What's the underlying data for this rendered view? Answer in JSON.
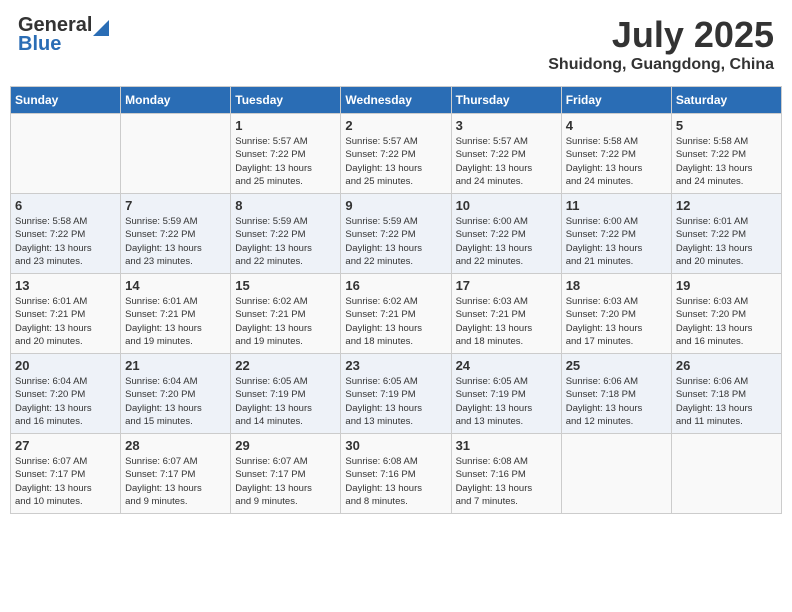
{
  "header": {
    "logo_general": "General",
    "logo_blue": "Blue",
    "month": "July 2025",
    "location": "Shuidong, Guangdong, China"
  },
  "weekdays": [
    "Sunday",
    "Monday",
    "Tuesday",
    "Wednesday",
    "Thursday",
    "Friday",
    "Saturday"
  ],
  "weeks": [
    [
      {
        "day": "",
        "info": ""
      },
      {
        "day": "",
        "info": ""
      },
      {
        "day": "1",
        "info": "Sunrise: 5:57 AM\nSunset: 7:22 PM\nDaylight: 13 hours\nand 25 minutes."
      },
      {
        "day": "2",
        "info": "Sunrise: 5:57 AM\nSunset: 7:22 PM\nDaylight: 13 hours\nand 25 minutes."
      },
      {
        "day": "3",
        "info": "Sunrise: 5:57 AM\nSunset: 7:22 PM\nDaylight: 13 hours\nand 24 minutes."
      },
      {
        "day": "4",
        "info": "Sunrise: 5:58 AM\nSunset: 7:22 PM\nDaylight: 13 hours\nand 24 minutes."
      },
      {
        "day": "5",
        "info": "Sunrise: 5:58 AM\nSunset: 7:22 PM\nDaylight: 13 hours\nand 24 minutes."
      }
    ],
    [
      {
        "day": "6",
        "info": "Sunrise: 5:58 AM\nSunset: 7:22 PM\nDaylight: 13 hours\nand 23 minutes."
      },
      {
        "day": "7",
        "info": "Sunrise: 5:59 AM\nSunset: 7:22 PM\nDaylight: 13 hours\nand 23 minutes."
      },
      {
        "day": "8",
        "info": "Sunrise: 5:59 AM\nSunset: 7:22 PM\nDaylight: 13 hours\nand 22 minutes."
      },
      {
        "day": "9",
        "info": "Sunrise: 5:59 AM\nSunset: 7:22 PM\nDaylight: 13 hours\nand 22 minutes."
      },
      {
        "day": "10",
        "info": "Sunrise: 6:00 AM\nSunset: 7:22 PM\nDaylight: 13 hours\nand 22 minutes."
      },
      {
        "day": "11",
        "info": "Sunrise: 6:00 AM\nSunset: 7:22 PM\nDaylight: 13 hours\nand 21 minutes."
      },
      {
        "day": "12",
        "info": "Sunrise: 6:01 AM\nSunset: 7:22 PM\nDaylight: 13 hours\nand 20 minutes."
      }
    ],
    [
      {
        "day": "13",
        "info": "Sunrise: 6:01 AM\nSunset: 7:21 PM\nDaylight: 13 hours\nand 20 minutes."
      },
      {
        "day": "14",
        "info": "Sunrise: 6:01 AM\nSunset: 7:21 PM\nDaylight: 13 hours\nand 19 minutes."
      },
      {
        "day": "15",
        "info": "Sunrise: 6:02 AM\nSunset: 7:21 PM\nDaylight: 13 hours\nand 19 minutes."
      },
      {
        "day": "16",
        "info": "Sunrise: 6:02 AM\nSunset: 7:21 PM\nDaylight: 13 hours\nand 18 minutes."
      },
      {
        "day": "17",
        "info": "Sunrise: 6:03 AM\nSunset: 7:21 PM\nDaylight: 13 hours\nand 18 minutes."
      },
      {
        "day": "18",
        "info": "Sunrise: 6:03 AM\nSunset: 7:20 PM\nDaylight: 13 hours\nand 17 minutes."
      },
      {
        "day": "19",
        "info": "Sunrise: 6:03 AM\nSunset: 7:20 PM\nDaylight: 13 hours\nand 16 minutes."
      }
    ],
    [
      {
        "day": "20",
        "info": "Sunrise: 6:04 AM\nSunset: 7:20 PM\nDaylight: 13 hours\nand 16 minutes."
      },
      {
        "day": "21",
        "info": "Sunrise: 6:04 AM\nSunset: 7:20 PM\nDaylight: 13 hours\nand 15 minutes."
      },
      {
        "day": "22",
        "info": "Sunrise: 6:05 AM\nSunset: 7:19 PM\nDaylight: 13 hours\nand 14 minutes."
      },
      {
        "day": "23",
        "info": "Sunrise: 6:05 AM\nSunset: 7:19 PM\nDaylight: 13 hours\nand 13 minutes."
      },
      {
        "day": "24",
        "info": "Sunrise: 6:05 AM\nSunset: 7:19 PM\nDaylight: 13 hours\nand 13 minutes."
      },
      {
        "day": "25",
        "info": "Sunrise: 6:06 AM\nSunset: 7:18 PM\nDaylight: 13 hours\nand 12 minutes."
      },
      {
        "day": "26",
        "info": "Sunrise: 6:06 AM\nSunset: 7:18 PM\nDaylight: 13 hours\nand 11 minutes."
      }
    ],
    [
      {
        "day": "27",
        "info": "Sunrise: 6:07 AM\nSunset: 7:17 PM\nDaylight: 13 hours\nand 10 minutes."
      },
      {
        "day": "28",
        "info": "Sunrise: 6:07 AM\nSunset: 7:17 PM\nDaylight: 13 hours\nand 9 minutes."
      },
      {
        "day": "29",
        "info": "Sunrise: 6:07 AM\nSunset: 7:17 PM\nDaylight: 13 hours\nand 9 minutes."
      },
      {
        "day": "30",
        "info": "Sunrise: 6:08 AM\nSunset: 7:16 PM\nDaylight: 13 hours\nand 8 minutes."
      },
      {
        "day": "31",
        "info": "Sunrise: 6:08 AM\nSunset: 7:16 PM\nDaylight: 13 hours\nand 7 minutes."
      },
      {
        "day": "",
        "info": ""
      },
      {
        "day": "",
        "info": ""
      }
    ]
  ]
}
